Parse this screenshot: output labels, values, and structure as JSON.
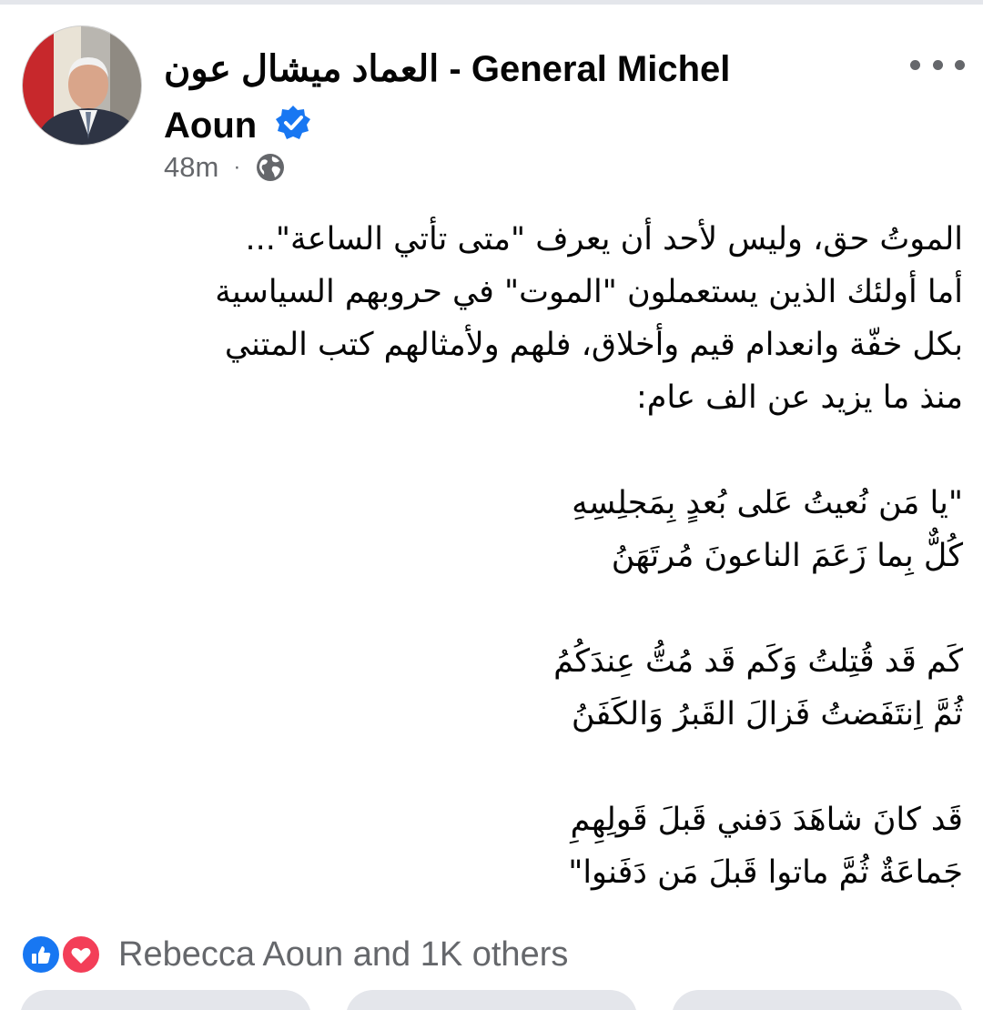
{
  "post": {
    "page_name_line1": "العماد ميشال عون - General Michel",
    "page_name_line2": "Aoun",
    "timestamp": "48m",
    "meta_separator": "·",
    "audience_icon": "globe-icon",
    "verified_icon": "verified-badge-icon",
    "more_icon": "more-options-icon",
    "body_lines": [
      "الموتُ حق، وليس لأحد أن يعرف \"متى تأتي الساعة\"...",
      "أما أولئك الذين يستعملون  \"الموت\" في حروبهم السياسية",
      "بكل خفّة وانعدام قيم وأخلاق، فلهم ولأمثالهم كتب المتني",
      "منذ ما يزيد عن الف عام:",
      "",
      "\"يا مَن نُعيتُ عَلى بُعدٍ بِمَجلِسِهِ",
      "كُلٌّ بِما زَعَمَ الناعونَ مُرتَهَنُ",
      "",
      "كَم قَد قُتِلتُ وَكَم قَد مُتُّ عِندَكُمُ",
      "ثُمَّ اِنتَفَضتُ فَزالَ القَبرُ وَالكَفَنُ",
      "",
      "قَد كانَ شاهَدَ دَفني قَبلَ قَولِهِمِ",
      "جَماعَةٌ ثُمَّ ماتوا قَبلَ مَن دَفَنوا\""
    ]
  },
  "reactions": {
    "summary": "Rebecca Aoun and 1K others",
    "icons": [
      "like-icon",
      "love-icon"
    ]
  },
  "colors": {
    "primary_text": "#050505",
    "secondary_text": "#65676b",
    "verified_blue": "#1877f2",
    "like_blue": "#1877f2",
    "love_red": "#f33e58",
    "button_gray": "#e4e6eb"
  }
}
